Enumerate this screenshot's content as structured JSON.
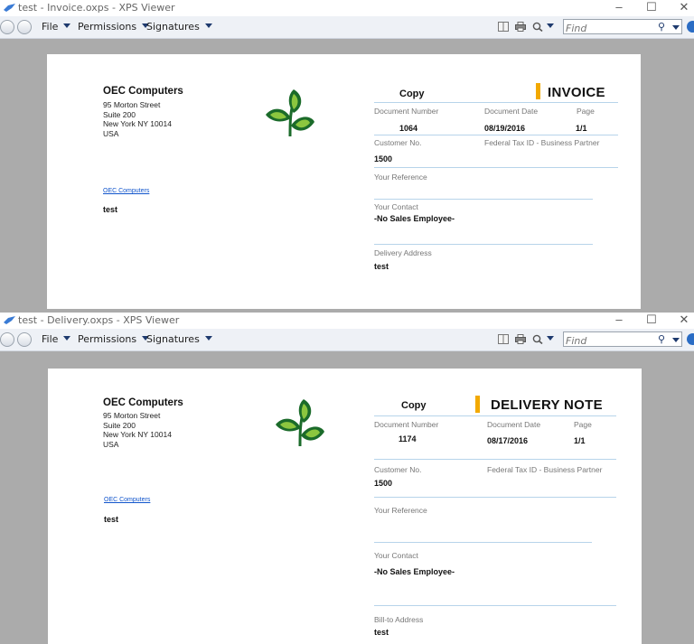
{
  "windows": [
    {
      "title": "test - Invoice.oxps - XPS Viewer",
      "menus": [
        "File",
        "Permissions",
        "Signatures"
      ],
      "find_placeholder": "Find",
      "window_controls": [
        "–",
        "☐",
        "✕"
      ],
      "document": {
        "company": "OEC Computers",
        "address_lines": [
          "95 Morton Street",
          "Suite 200",
          "New York NY  10014",
          "USA"
        ],
        "company_link": "OEC Computers",
        "recipient": "test",
        "copy_label": "Copy",
        "doc_type": "INVOICE",
        "labels": {
          "doc_number": "Document Number",
          "doc_date": "Document Date",
          "page": "Page",
          "customer_no": "Customer No.",
          "tax_id": "Federal Tax ID - Business Partner",
          "your_reference": "Your Reference",
          "your_contact": "Your Contact",
          "address": "Delivery Address"
        },
        "values": {
          "doc_number": "1064",
          "doc_date": "08/19/2016",
          "page": "1/1",
          "customer_no": "1500",
          "contact": "-No Sales Employee-",
          "address": "test"
        }
      }
    },
    {
      "title": "test - Delivery.oxps - XPS Viewer",
      "menus": [
        "File",
        "Permissions",
        "Signatures"
      ],
      "find_placeholder": "Find",
      "window_controls": [
        "–",
        "☐",
        "✕"
      ],
      "document": {
        "company": "OEC Computers",
        "address_lines": [
          "95 Morton Street",
          "Suite 200",
          "New York NY  10014",
          "USA"
        ],
        "company_link": "OEC Computers",
        "recipient": "test",
        "copy_label": "Copy",
        "doc_type": "DELIVERY NOTE",
        "labels": {
          "doc_number": "Document Number",
          "doc_date": "Document Date",
          "page": "Page",
          "customer_no": "Customer No.",
          "tax_id": "Federal Tax ID - Business Partner",
          "your_reference": "Your Reference",
          "your_contact": "Your Contact",
          "address": "Bill-to Address"
        },
        "values": {
          "doc_number": "1174",
          "doc_date": "08/17/2016",
          "page": "1/1",
          "customer_no": "1500",
          "contact": "-No Sales Employee-",
          "address": "test"
        }
      }
    }
  ],
  "colors": {
    "accent_bar": "#f2a900",
    "logo_dark_green": "#1b6b2a",
    "logo_light_green": "#8cc63f",
    "rule_line": "#b7d4ea",
    "viewer_background": "#ababab"
  }
}
